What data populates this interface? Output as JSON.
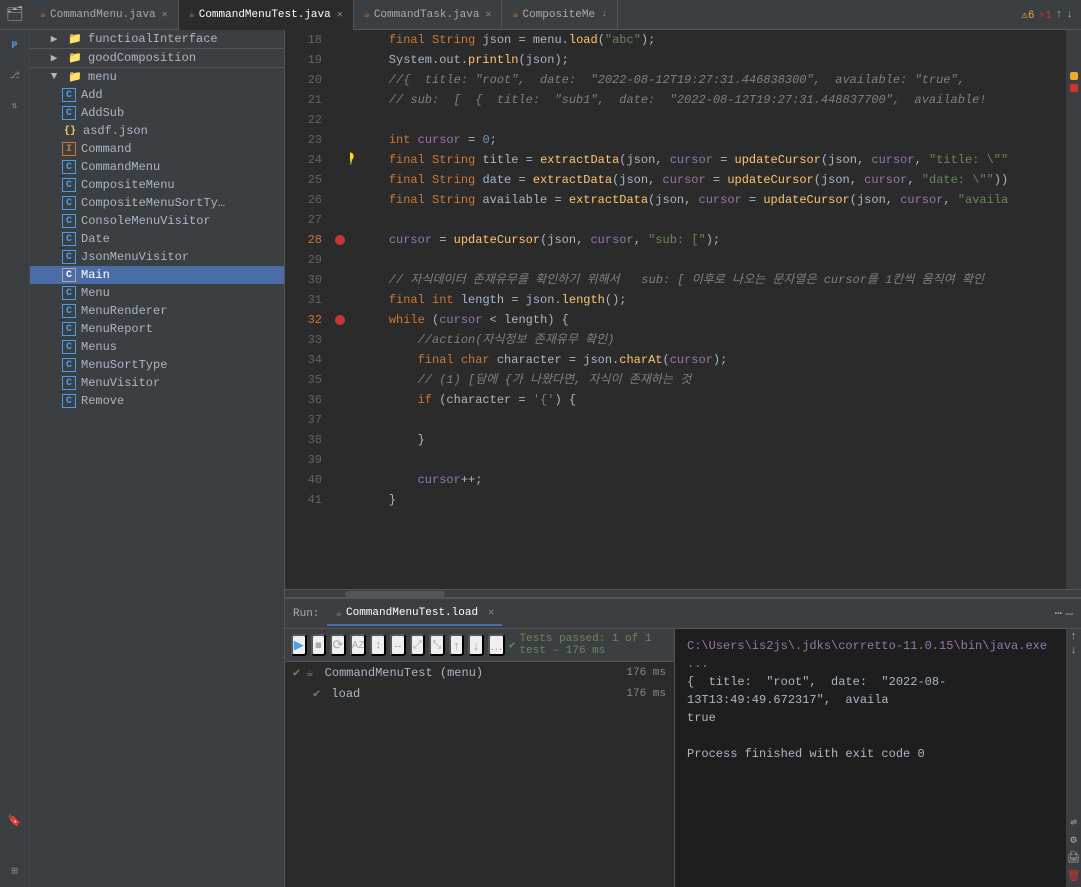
{
  "tabs": [
    {
      "id": "commandmenu-java",
      "label": "CommandMenu.java",
      "active": false,
      "icon": "☕"
    },
    {
      "id": "commandmenutest-java",
      "label": "CommandMenuTest.java",
      "active": true,
      "icon": "☕"
    },
    {
      "id": "commandtask-java",
      "label": "CommandTask.java",
      "active": false,
      "icon": "☕"
    },
    {
      "id": "compositeme",
      "label": "CompositeMe",
      "active": false,
      "icon": "☕"
    }
  ],
  "warnings": {
    "count": 6,
    "label": "⚠6"
  },
  "errors": {
    "count": 1,
    "label": "⚡1"
  },
  "sidebar": {
    "items": [
      {
        "id": "functionalinterface",
        "label": "functioalInterface",
        "type": "folder",
        "icon": "📁",
        "indent": 1
      },
      {
        "id": "goodcomposition",
        "label": "goodComposition",
        "type": "folder",
        "icon": "📁",
        "indent": 1
      },
      {
        "id": "menu-folder",
        "label": "menu",
        "type": "folder",
        "icon": "📁",
        "indent": 1,
        "expanded": true
      },
      {
        "id": "add",
        "label": "Add",
        "type": "class",
        "icon": "C",
        "indent": 2
      },
      {
        "id": "addsub",
        "label": "AddSub",
        "type": "class",
        "icon": "C",
        "indent": 2
      },
      {
        "id": "asdf-json",
        "label": "asdf.json",
        "type": "json",
        "icon": "{}",
        "indent": 2
      },
      {
        "id": "command",
        "label": "Command",
        "type": "interface",
        "icon": "I",
        "indent": 2
      },
      {
        "id": "commandmenu",
        "label": "CommandMenu",
        "type": "class",
        "icon": "C",
        "indent": 2
      },
      {
        "id": "compositemenu",
        "label": "CompositeMenu",
        "type": "class",
        "icon": "C",
        "indent": 2
      },
      {
        "id": "compositemenusorttype",
        "label": "CompositeMenuSortTy…",
        "type": "class",
        "icon": "C",
        "indent": 2
      },
      {
        "id": "consolemenuvisitor",
        "label": "ConsoleMenuVisitor",
        "type": "class",
        "icon": "C",
        "indent": 2
      },
      {
        "id": "date",
        "label": "Date",
        "type": "class",
        "icon": "C",
        "indent": 2
      },
      {
        "id": "jsonmenuvisitor",
        "label": "JsonMenuVisitor",
        "type": "class",
        "icon": "C",
        "indent": 2
      },
      {
        "id": "main",
        "label": "Main",
        "type": "class",
        "icon": "C",
        "indent": 2,
        "active": true
      },
      {
        "id": "menu",
        "label": "Menu",
        "type": "class",
        "icon": "C",
        "indent": 2
      },
      {
        "id": "menurenderer",
        "label": "MenuRenderer",
        "type": "class",
        "icon": "C",
        "indent": 2
      },
      {
        "id": "menureport",
        "label": "MenuReport",
        "type": "class",
        "icon": "C",
        "indent": 2
      },
      {
        "id": "menus",
        "label": "Menus",
        "type": "class",
        "icon": "C",
        "indent": 2
      },
      {
        "id": "menusorttype",
        "label": "MenuSortType",
        "type": "class",
        "icon": "C",
        "indent": 2
      },
      {
        "id": "menuvisitor",
        "label": "MenuVisitor",
        "type": "class",
        "icon": "C",
        "indent": 2
      },
      {
        "id": "remove",
        "label": "Remove",
        "type": "class",
        "icon": "C",
        "indent": 2
      }
    ]
  },
  "code_lines": [
    {
      "num": 18,
      "content": "    <kw>final</kw> <kw>String</kw> json = menu.<fn>load</fn>(<str>\"abc\"</str>);",
      "has_breakpoint": false
    },
    {
      "num": 19,
      "content": "    System.out.<fn>println</fn>(json);",
      "has_breakpoint": false
    },
    {
      "num": 20,
      "content": "    <comment>// {  title: \"root\",  date:  \"2022-08-12T19:27:31.446838300\",  available: \"true\",</comment>",
      "has_breakpoint": false
    },
    {
      "num": 21,
      "content": "    <comment>// sub:  [  {  title:  \"sub1\",  date:  \"2022-08-12T19:27:31.448837700\",  available:</comment>",
      "has_breakpoint": false
    },
    {
      "num": 22,
      "content": "",
      "has_breakpoint": false
    },
    {
      "num": 23,
      "content": "    <kw>int</kw> <var-ref>cursor</var-ref> = <num>0</num>;",
      "has_breakpoint": false
    },
    {
      "num": 24,
      "content": "    <kw>final</kw> <kw>String</kw> title = <fn>extractData</fn>(json, <var-ref>cursor</var-ref> = <fn>updateCursor</fn>(json, <var-ref>cursor</var-ref>, <str>\"title: \\\"\"</str>)",
      "has_breakpoint": false,
      "has_bulb": true
    },
    {
      "num": 25,
      "content": "    <kw>final</kw> <kw>String</kw> date = <fn>extractData</fn>(json, <var-ref>cursor</var-ref> = <fn>updateCursor</fn>(json, <var-ref>cursor</var-ref>, <str>\"date: \\\"\"</str>))",
      "has_breakpoint": false
    },
    {
      "num": 26,
      "content": "    <kw>final</kw> <kw>String</kw> available = <fn>extractData</fn>(json, <var-ref>cursor</var-ref> = <fn>updateCursor</fn>(json, <var-ref>cursor</var-ref>, <str>\"availa</str>",
      "has_breakpoint": false
    },
    {
      "num": 27,
      "content": "",
      "has_breakpoint": false
    },
    {
      "num": 28,
      "content": "    <var-ref>cursor</var-ref> = <fn>updateCursor</fn>(json, <var-ref>cursor</var-ref>, <str>\"sub: [\"</str>);",
      "has_breakpoint": true
    },
    {
      "num": 29,
      "content": "",
      "has_breakpoint": false
    },
    {
      "num": 30,
      "content": "    <comment>// 자식데이터 존재유무를 확인하기 위해서   sub: [ 이후로 나오는 문자열은 cursor를 1칸씩 움직여 확인</comment>",
      "has_breakpoint": false
    },
    {
      "num": 31,
      "content": "    <kw>final</kw> <kw>int</kw> length = json.<fn>length</fn>();",
      "has_breakpoint": false
    },
    {
      "num": 32,
      "content": "    <kw>while</kw> (<var-ref>cursor</var-ref> &lt; length) {",
      "has_breakpoint": true
    },
    {
      "num": 33,
      "content": "        <comment>//action(자식정보 존재유무 확인)</comment>",
      "has_breakpoint": false
    },
    {
      "num": 34,
      "content": "        <kw>final</kw> <kw>char</kw> character = json.<fn>charAt</fn>(<var-ref>cursor</var-ref>);",
      "has_breakpoint": false
    },
    {
      "num": 35,
      "content": "        <comment>// (1) [담에 {가 나왔다면, 자식이 존재하는 것</comment>",
      "has_breakpoint": false
    },
    {
      "num": 36,
      "content": "        <kw>if</kw> (character = <str>'{'</str>) {",
      "has_breakpoint": false
    },
    {
      "num": 37,
      "content": "",
      "has_breakpoint": false
    },
    {
      "num": 38,
      "content": "        }",
      "has_breakpoint": false
    },
    {
      "num": 39,
      "content": "",
      "has_breakpoint": false
    },
    {
      "num": 40,
      "content": "        <var-ref>cursor</var-ref>++;",
      "has_breakpoint": false
    },
    {
      "num": 41,
      "content": "    }",
      "has_breakpoint": false
    }
  ],
  "run_panel": {
    "title": "Run:",
    "tab_label": "CommandMenuTest.load",
    "toolbar_buttons": [
      "▶",
      "⏹",
      "⟳",
      "AZ",
      "↕",
      "↔",
      "⤢",
      "⤡",
      "↑",
      "↓",
      "…"
    ],
    "status": "✔ Tests passed: 1 of 1 test – 176 ms",
    "tree": [
      {
        "id": "commandmenutest",
        "label": "CommandMenuTest (menu)",
        "time": "176 ms",
        "icon": "✔",
        "indent": 0
      },
      {
        "id": "load",
        "label": "load",
        "time": "176 ms",
        "icon": "✔",
        "indent": 1
      }
    ],
    "output_lines": [
      "C:\\Users\\is2js\\.jdks\\corretto-11.0.15\\bin\\java.exe ...",
      "{ title: \"root\",  date:  \"2022-08-13T13:49:49.672317\",  availa",
      "true",
      "",
      "Process finished with exit code 0"
    ]
  },
  "icons": {
    "play": "▶",
    "stop": "⏹",
    "rerun": "🔄",
    "close": "✕",
    "chevron_down": "▼",
    "chevron_right": "▶",
    "warning": "⚠",
    "error": "⚡",
    "check": "✔",
    "lightbulb": "💡",
    "up_arrow": "↑",
    "down_arrow": "↓",
    "gear": "⚙",
    "dots": "…"
  }
}
